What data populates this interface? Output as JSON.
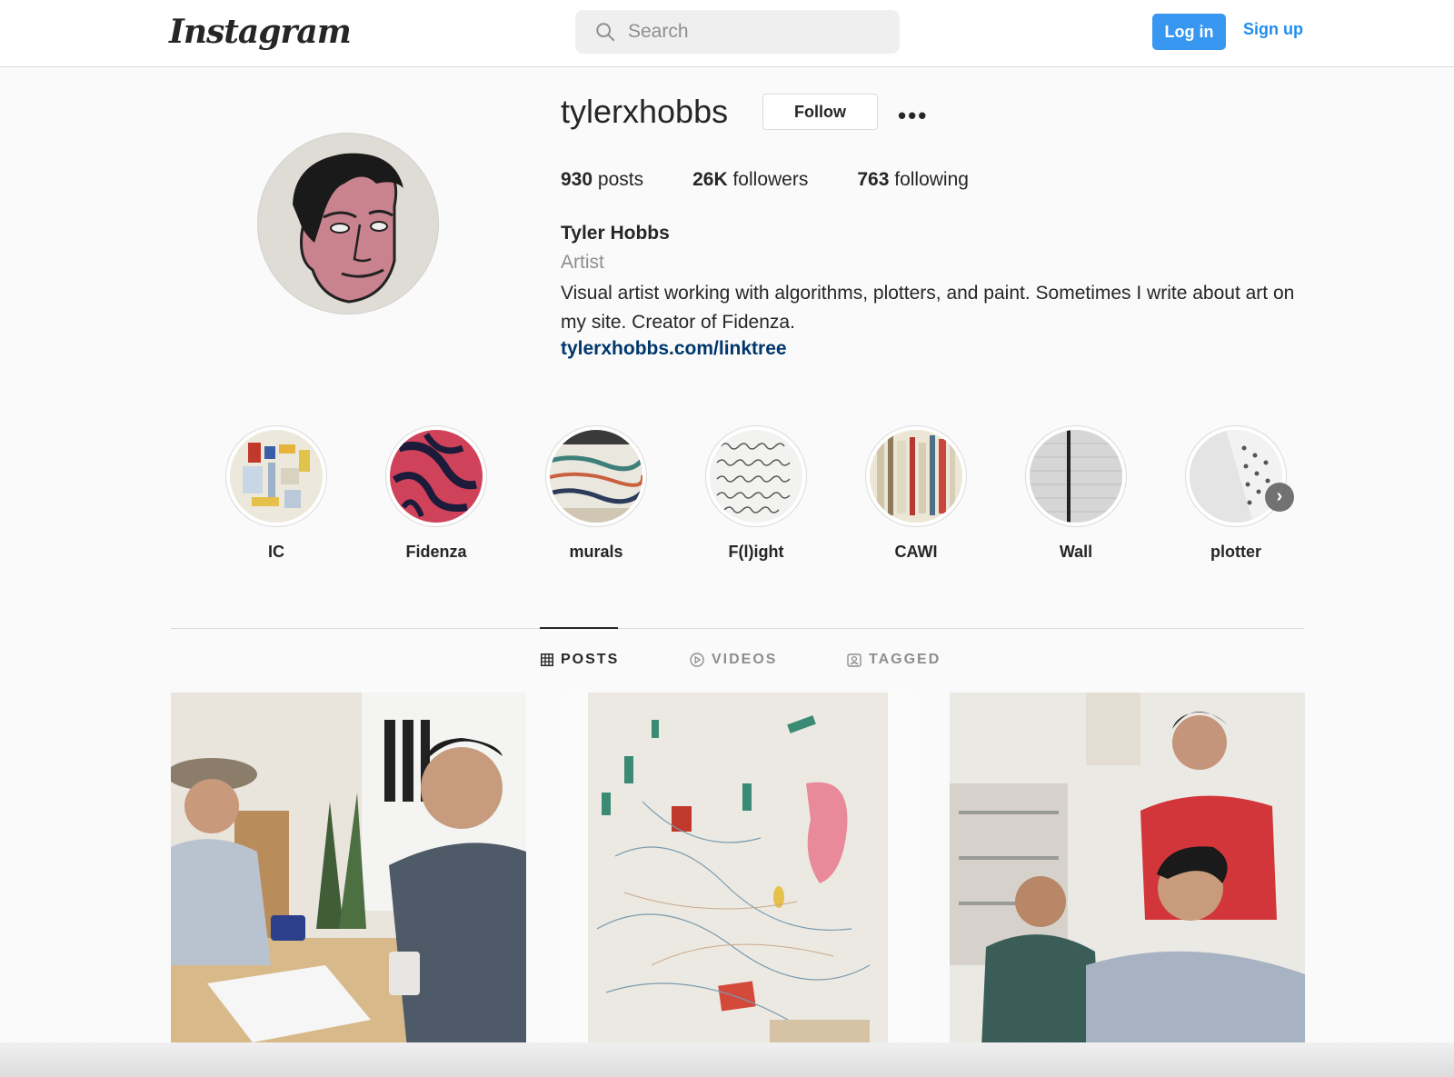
{
  "header": {
    "logo_text": "Instagram",
    "search_placeholder": "Search",
    "login_label": "Log in",
    "signup_label": "Sign up"
  },
  "profile": {
    "username": "tylerxhobbs",
    "follow_label": "Follow",
    "more_icon": "more-horizontal-icon",
    "stats": [
      {
        "value": "930",
        "label": "posts"
      },
      {
        "value": "26K",
        "label": "followers"
      },
      {
        "value": "763",
        "label": "following"
      }
    ],
    "full_name": "Tyler Hobbs",
    "category": "Artist",
    "bio": "Visual artist working with algorithms, plotters, and paint. Sometimes I write about art on my site. Creator of Fidenza.",
    "link": "tylerxhobbs.com/linktree"
  },
  "highlights": [
    {
      "label": "IC"
    },
    {
      "label": "Fidenza"
    },
    {
      "label": "murals"
    },
    {
      "label": "F(l)ight"
    },
    {
      "label": "CAWI"
    },
    {
      "label": "Wall"
    },
    {
      "label": "plotter"
    }
  ],
  "tabs": [
    {
      "label": "POSTS",
      "icon": "grid-icon",
      "active": true
    },
    {
      "label": "VIDEOS",
      "icon": "play-icon",
      "active": false
    },
    {
      "label": "TAGGED",
      "icon": "tag-user-icon",
      "active": false
    }
  ],
  "colors": {
    "accent": "#3897f0",
    "link": "#00376b",
    "muted": "#8e8e8e"
  }
}
